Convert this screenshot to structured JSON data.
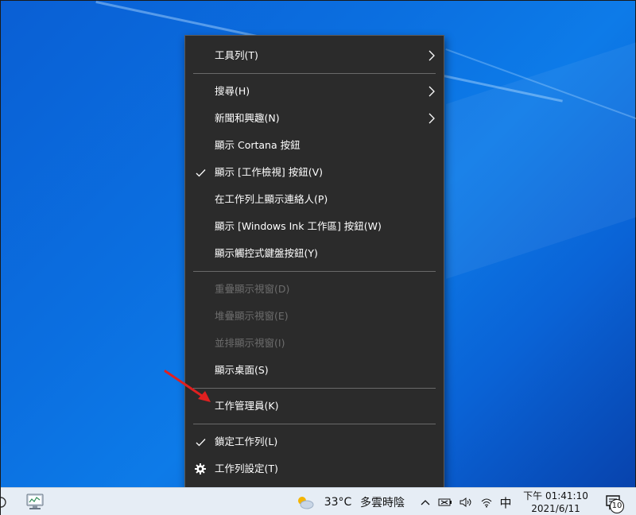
{
  "context_menu": {
    "items": [
      {
        "label": "工具列(T)"
      },
      {
        "label": "搜尋(H)"
      },
      {
        "label": "新聞和興趣(N)"
      },
      {
        "label": "顯示 Cortana 按鈕"
      },
      {
        "label": "顯示 [工作檢視] 按鈕(V)"
      },
      {
        "label": "在工作列上顯示連絡人(P)"
      },
      {
        "label": "顯示 [Windows Ink 工作區] 按鈕(W)"
      },
      {
        "label": "顯示觸控式鍵盤按鈕(Y)"
      },
      {
        "label": "重疊顯示視窗(D)"
      },
      {
        "label": "堆疊顯示視窗(E)"
      },
      {
        "label": "並排顯示視窗(I)"
      },
      {
        "label": "顯示桌面(S)"
      },
      {
        "label": "工作管理員(K)"
      },
      {
        "label": "鎖定工作列(L)"
      },
      {
        "label": "工作列設定(T)"
      }
    ]
  },
  "taskbar": {
    "weather": {
      "temperature": "33°C",
      "condition": "多雲時陰"
    },
    "ime": "中",
    "clock": {
      "time": "下午 01:41:10",
      "date": "2021/6/11"
    },
    "notification_count": "10"
  },
  "colors": {
    "menu_bg": "#2b2b2b",
    "menu_text": "#ffffff",
    "menu_disabled_text": "#6d6d6d",
    "annotation_arrow": "#e02020"
  },
  "icons": {
    "submenu": "chevron-right-icon",
    "checked": "checkmark-icon",
    "settings": "gear-icon"
  }
}
